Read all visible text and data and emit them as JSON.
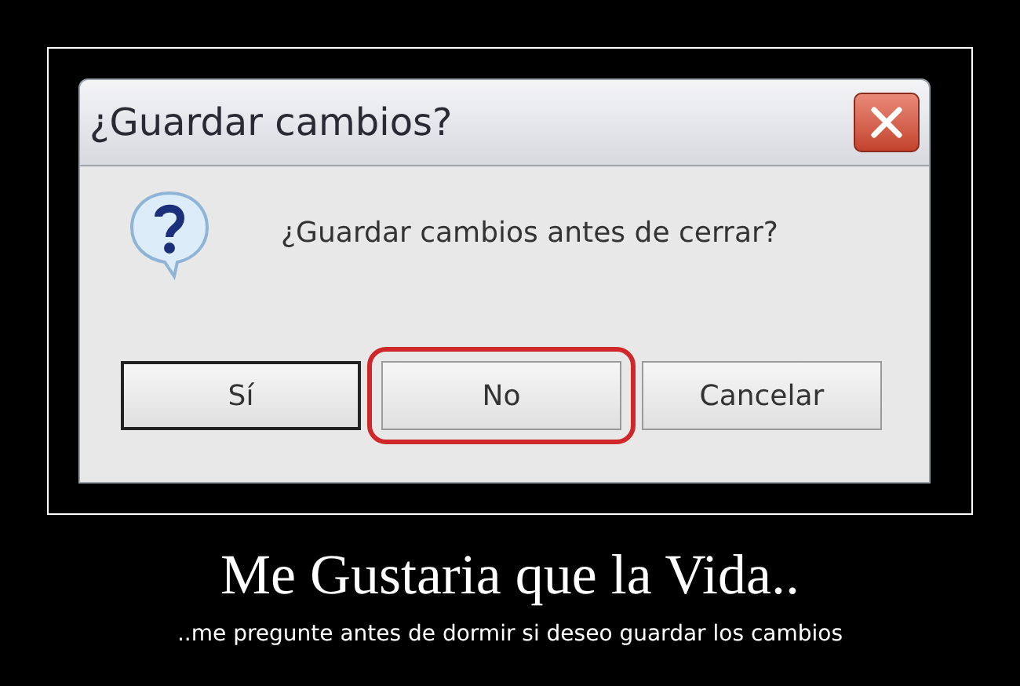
{
  "dialog": {
    "title": "¿Guardar cambios?",
    "message": "¿Guardar cambios antes de cerrar?",
    "buttons": [
      {
        "label": "Sí",
        "default": true,
        "circled": false
      },
      {
        "label": "No",
        "default": false,
        "circled": true
      },
      {
        "label": "Cancelar",
        "default": false,
        "circled": false
      }
    ]
  },
  "caption": {
    "title": "Me Gustaria que la Vida..",
    "subtitle": "..me pregunte antes de dormir si deseo guardar los cambios"
  }
}
